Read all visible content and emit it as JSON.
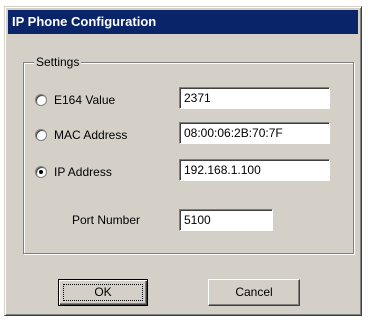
{
  "window": {
    "title": "IP Phone Configuration"
  },
  "settings": {
    "legend": "Settings",
    "options": [
      {
        "label": "E164 Value",
        "value": "2371",
        "selected": false
      },
      {
        "label": "MAC Address",
        "value": "08:00:06:2B:70:7F",
        "selected": false
      },
      {
        "label": "IP Address",
        "value": "192.168.1.100",
        "selected": true
      }
    ],
    "port": {
      "label": "Port Number",
      "value": "5100"
    }
  },
  "buttons": {
    "ok_label": "OK",
    "cancel_label": "Cancel"
  },
  "colors": {
    "titlebar": "#0a246a",
    "dialog_face": "#d4d0c8"
  }
}
